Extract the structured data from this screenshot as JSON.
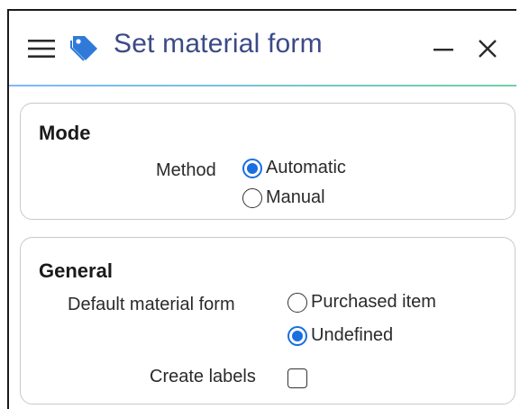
{
  "window": {
    "title": "Set material form",
    "menu_icon": "hamburger-menu-icon",
    "title_icon": "tag-icon",
    "minimize_icon": "minimize-icon",
    "close_icon": "close-icon"
  },
  "colors": {
    "title_text": "#3b4a86",
    "tag_icon": "#2f7ad8",
    "radio_selected": "#1a6fe0",
    "accent_line_start": "#7fb8ff",
    "accent_line_end": "#6fd0a6",
    "panel_border": "#c9c9c9"
  },
  "mode": {
    "title": "Mode",
    "method_label": "Method",
    "options": [
      {
        "label": "Automatic",
        "selected": true
      },
      {
        "label": "Manual",
        "selected": false
      }
    ]
  },
  "general": {
    "title": "General",
    "default_material_form_label": "Default material form",
    "options": [
      {
        "label": "Purchased item",
        "selected": false
      },
      {
        "label": "Undefined",
        "selected": true
      }
    ],
    "create_labels_label": "Create labels",
    "create_labels_checked": false
  }
}
